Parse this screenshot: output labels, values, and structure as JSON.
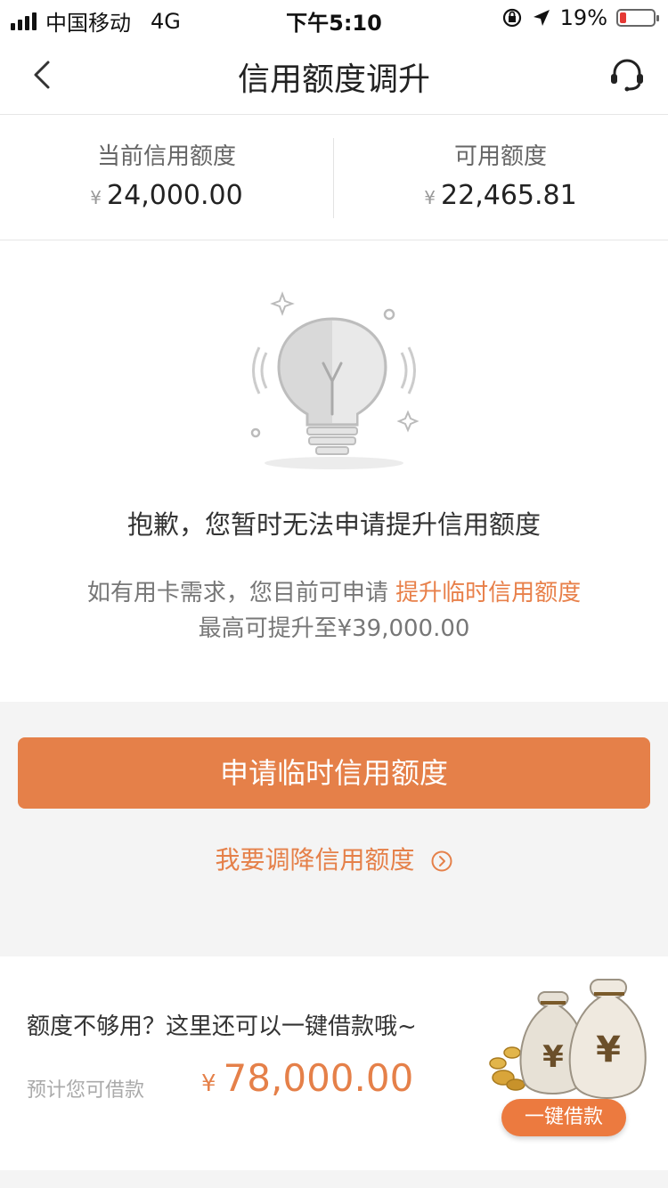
{
  "status_bar": {
    "carrier": "中国移动",
    "network": "4G",
    "time": "下午5:10",
    "battery": "19%"
  },
  "nav": {
    "title": "信用额度调升"
  },
  "quota": {
    "current_label": "当前信用额度",
    "currency": "¥",
    "current_value": "24,000.00",
    "available_label": "可用额度",
    "available_value": "22,465.81"
  },
  "message": {
    "sorry": "抱歉，您暂时无法申请提升信用额度",
    "hint_prefix": "如有用卡需求，您目前可申请 ",
    "hint_link": "提升临时信用额度",
    "hint_max": "最高可提升至¥39,000.00"
  },
  "actions": {
    "apply_label": "申请临时信用额度",
    "reduce_label": "我要调降信用额度"
  },
  "promo": {
    "question": "额度不够用？这里还可以一键借款哦~",
    "estimate_label": "预计您可借款",
    "currency": "¥",
    "amount": "78,000.00",
    "loan_button": "一键借款"
  },
  "colors": {
    "accent": "#e58049",
    "battery_low": "#e53935"
  },
  "icons": [
    "back-icon",
    "customer-service-icon",
    "lightbulb-icon",
    "chevron-circle-icon",
    "money-bags-icon",
    "location-arrow-icon",
    "rotation-lock-icon"
  ]
}
